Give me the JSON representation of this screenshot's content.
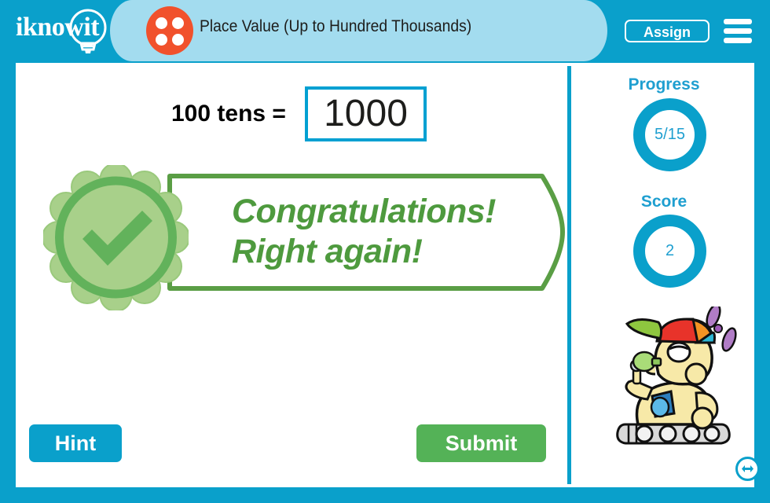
{
  "header": {
    "logo_text": "iknowit",
    "logo_icon": "lightbulb-icon",
    "topic_icon": "four-dot-dice-icon",
    "topic_title": "Place Value (Up to Hundred Thousands)",
    "assign_label": "Assign",
    "menu_icon": "hamburger-menu-icon"
  },
  "question": {
    "prompt": "100 tens =",
    "answer_value": "1000",
    "answer_placeholder": ""
  },
  "feedback": {
    "line1": "Congratulations!",
    "line2": "Right again!",
    "badge_icon": "green-check-rosette-icon"
  },
  "actions": {
    "hint_label": "Hint",
    "submit_label": "Submit"
  },
  "stats": {
    "progress_label": "Progress",
    "progress_value": "5/15",
    "score_label": "Score",
    "score_value": "2"
  },
  "mascot": {
    "name": "robot-mascot-with-propeller-cap",
    "resize_icon": "left-right-arrow-icon"
  },
  "colors": {
    "brand_blue": "#0aa0cb",
    "light_blue": "#a3dcef",
    "accent_red": "#f1512c",
    "success_green": "#4e9a3e",
    "submit_green": "#54b257",
    "badge_light_green": "#a8d08a",
    "badge_mid_green": "#62b25b",
    "input_border_blue": "#00a0d2"
  }
}
